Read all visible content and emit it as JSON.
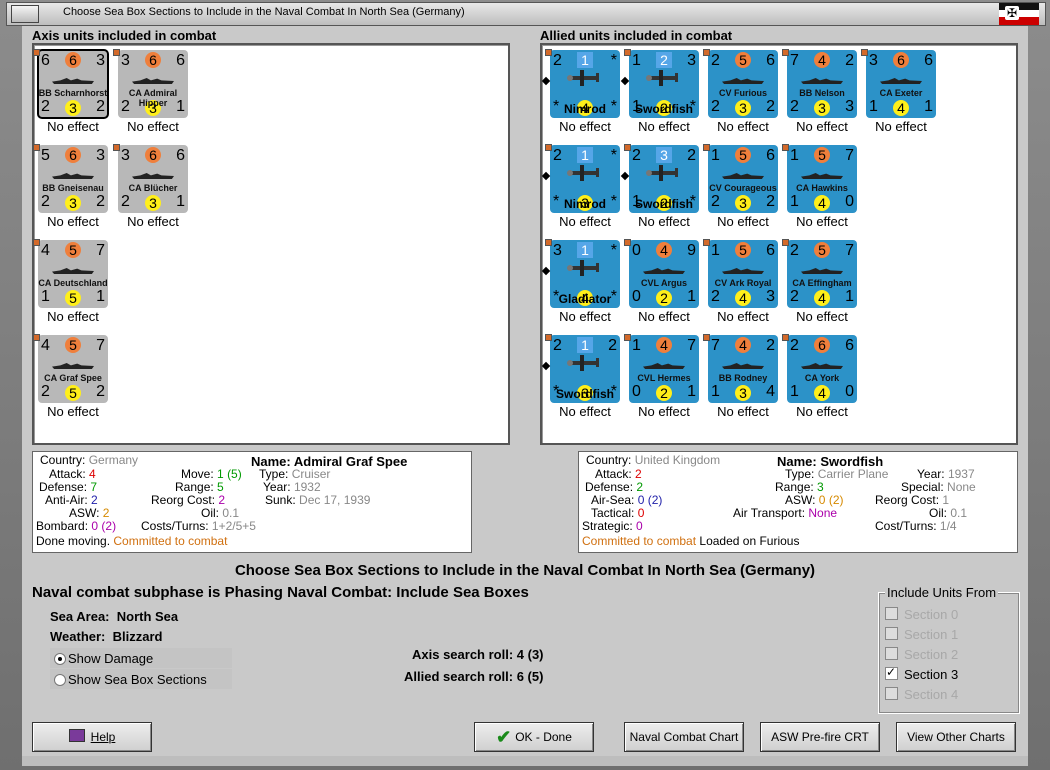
{
  "window": {
    "title": "Choose Sea Box Sections to Include in the Naval Combat In North Sea (Germany)"
  },
  "axis": {
    "label": "Axis units included in combat",
    "units": [
      {
        "name": "BB Scharnhorst",
        "tl": "6",
        "tc": "6",
        "tr": "3",
        "bl": "2",
        "bc": "3",
        "br": "2",
        "effect": "No effect",
        "selected": true
      },
      {
        "name": "CA Admiral Hipper",
        "tl": "3",
        "tc": "6",
        "tr": "6",
        "bl": "2",
        "bc": "3",
        "br": "1",
        "effect": "No effect"
      },
      {
        "name": "BB Gneisenau",
        "tl": "5",
        "tc": "6",
        "tr": "3",
        "bl": "2",
        "bc": "3",
        "br": "2",
        "effect": "No effect"
      },
      {
        "name": "CA Blücher",
        "tl": "3",
        "tc": "6",
        "tr": "6",
        "bl": "2",
        "bc": "3",
        "br": "1",
        "effect": "No effect"
      },
      {
        "name": "CA Deutschland",
        "tl": "4",
        "tc": "5",
        "tr": "7",
        "bl": "1",
        "bc": "5",
        "br": "1",
        "effect": "No effect"
      },
      {
        "name": "CA Graf Spee",
        "tl": "4",
        "tc": "5",
        "tr": "7",
        "bl": "2",
        "bc": "5",
        "br": "2",
        "effect": "No effect"
      }
    ]
  },
  "allied": {
    "label": "Allied units included in combat",
    "units": [
      {
        "name": "Nimrod",
        "kind": "plane",
        "tl": "2",
        "tc": "1",
        "tr": "*",
        "bl": "*",
        "bc": "4",
        "br": "*",
        "effect": "No effect"
      },
      {
        "name": "Swordfish",
        "kind": "plane",
        "tl": "1",
        "tc": "2",
        "tr": "3",
        "bl": "1",
        "bc": "2",
        "br": "*",
        "effect": "No effect"
      },
      {
        "name": "CV Furious",
        "tl": "2",
        "tc": "5",
        "tr": "6",
        "bl": "2",
        "bc": "3",
        "br": "2",
        "effect": "No effect"
      },
      {
        "name": "BB Nelson",
        "tl": "7",
        "tc": "4",
        "tr": "2",
        "bl": "2",
        "bc": "3",
        "br": "3",
        "effect": "No effect"
      },
      {
        "name": "CA Exeter",
        "tl": "3",
        "tc": "6",
        "tr": "6",
        "bl": "1",
        "bc": "4",
        "br": "1",
        "effect": "No effect"
      },
      {
        "name": "Nimrod",
        "kind": "plane",
        "tl": "2",
        "tc": "1",
        "tr": "*",
        "bl": "*",
        "bc": "3",
        "br": "*",
        "effect": "No effect"
      },
      {
        "name": "Swordfish",
        "kind": "plane",
        "tl": "2",
        "tc": "3",
        "tr": "2",
        "bl": "1",
        "bc": "2",
        "br": "*",
        "effect": "No effect"
      },
      {
        "name": "CV Courageous",
        "tl": "1",
        "tc": "5",
        "tr": "6",
        "bl": "2",
        "bc": "3",
        "br": "2",
        "effect": "No effect"
      },
      {
        "name": "CA Hawkins",
        "tl": "1",
        "tc": "5",
        "tr": "7",
        "bl": "1",
        "bc": "4",
        "br": "0",
        "effect": "No effect"
      },
      {
        "name": "Gladiator",
        "kind": "plane",
        "tl": "3",
        "tc": "1",
        "tr": "*",
        "bl": "*",
        "bc": "4",
        "br": "*",
        "effect": "No effect"
      },
      {
        "name": "CVL Argus",
        "tl": "0",
        "tc": "4",
        "tr": "9",
        "bl": "0",
        "bc": "2",
        "br": "1",
        "effect": "No effect"
      },
      {
        "name": "CV Ark Royal",
        "tl": "1",
        "tc": "5",
        "tr": "6",
        "bl": "2",
        "bc": "4",
        "br": "3",
        "effect": "No effect"
      },
      {
        "name": "CA Effingham",
        "tl": "2",
        "tc": "5",
        "tr": "7",
        "bl": "2",
        "bc": "4",
        "br": "1",
        "effect": "No effect"
      },
      {
        "name": "Swordfish",
        "kind": "plane",
        "tl": "2",
        "tc": "1",
        "tr": "2",
        "bl": "*",
        "bc": "3",
        "br": "*",
        "effect": "No effect"
      },
      {
        "name": "CVL Hermes",
        "tl": "1",
        "tc": "4",
        "tr": "7",
        "bl": "0",
        "bc": "2",
        "br": "1",
        "effect": "No effect"
      },
      {
        "name": "BB Rodney",
        "tl": "7",
        "tc": "4",
        "tr": "2",
        "bl": "1",
        "bc": "3",
        "br": "4",
        "effect": "No effect"
      },
      {
        "name": "CA York",
        "tl": "2",
        "tc": "6",
        "tr": "6",
        "bl": "1",
        "bc": "4",
        "br": "0",
        "effect": "No effect"
      }
    ]
  },
  "axis_info": {
    "country_k": "Country:",
    "country_v": "Germany",
    "name_k": "Name:",
    "name_v": "Admiral Graf Spee",
    "attack_k": "Attack:",
    "attack_v": "4",
    "move_k": "Move:",
    "move_v": "1",
    "move_v2": "(5)",
    "type_k": "Type:",
    "type_v": "Cruiser",
    "defense_k": "Defense:",
    "defense_v": "7",
    "range_k": "Range:",
    "range_v": "5",
    "year_k": "Year:",
    "year_v": "1932",
    "aa_k": "Anti-Air:",
    "aa_v": "2",
    "reorg_k": "Reorg Cost:",
    "reorg_v": "2",
    "sunk_k": "Sunk:",
    "sunk_v": "Dec 17, 1939",
    "asw_k": "ASW:",
    "asw_v": "2",
    "oil_k": "Oil:",
    "oil_v": "0.1",
    "bombard_k": "Bombard:",
    "bombard_v": "0",
    "bombard_v2": "(2)",
    "costs_k": "Costs/Turns:",
    "costs_v": "1+2/5+5",
    "status1": "Done moving.",
    "status2": "Committed to combat"
  },
  "allied_info": {
    "country_k": "Country:",
    "country_v": "United Kingdom",
    "name_k": "Name:",
    "name_v": "Swordfish",
    "attack_k": "Attack:",
    "attack_v": "2",
    "type_k": "Type:",
    "type_v": "Carrier Plane",
    "year_k": "Year:",
    "year_v": "1937",
    "defense_k": "Defense:",
    "defense_v": "2",
    "range_k": "Range:",
    "range_v": "3",
    "special_k": "Special:",
    "special_v": "None",
    "airsea_k": "Air-Sea:",
    "airsea_v": "0",
    "airsea_v2": "(2)",
    "asw_k": "ASW:",
    "asw_v": "0",
    "asw_v2": "(2)",
    "reorg_k": "Reorg Cost:",
    "reorg_v": "1",
    "tac_k": "Tactical:",
    "tac_v": "0",
    "airtrans_k": "Air Transport:",
    "airtrans_v": "None",
    "oil_k": "Oil:",
    "oil_v": "0.1",
    "strat_k": "Strategic:",
    "strat_v": "0",
    "costs_k": "Cost/Turns:",
    "costs_v": "1/4",
    "status1": "Committed to combat",
    "status2": "Loaded on Furious"
  },
  "main": {
    "title": "Choose Sea Box Sections to Include in the Naval Combat In North Sea (Germany)",
    "subphase": "Naval combat subphase is Phasing Naval Combat: Include Sea Boxes",
    "sea_area_k": "Sea Area:",
    "sea_area_v": "North Sea",
    "weather_k": "Weather:",
    "weather_v": "Blizzard",
    "show_damage": "Show Damage",
    "show_sections": "Show Sea Box Sections",
    "axis_roll": "Axis search roll: 4 (3)",
    "allied_roll": "Allied search roll: 6 (5)"
  },
  "include": {
    "title": "Include Units From",
    "sections": [
      {
        "label": "Section 0",
        "checked": false
      },
      {
        "label": "Section 1",
        "checked": false
      },
      {
        "label": "Section 2",
        "checked": false
      },
      {
        "label": "Section 3",
        "checked": true
      },
      {
        "label": "Section 4",
        "checked": false
      }
    ]
  },
  "buttons": {
    "help": "Help",
    "ok": "OK - Done",
    "naval_chart": "Naval Combat Chart",
    "asw": "ASW Pre-fire CRT",
    "other": "View Other Charts"
  },
  "colors": {
    "allied": "#2c92c8",
    "axis": "#b8b8b8",
    "attack": "#ef7f3c",
    "defense": "#ffef1a"
  }
}
